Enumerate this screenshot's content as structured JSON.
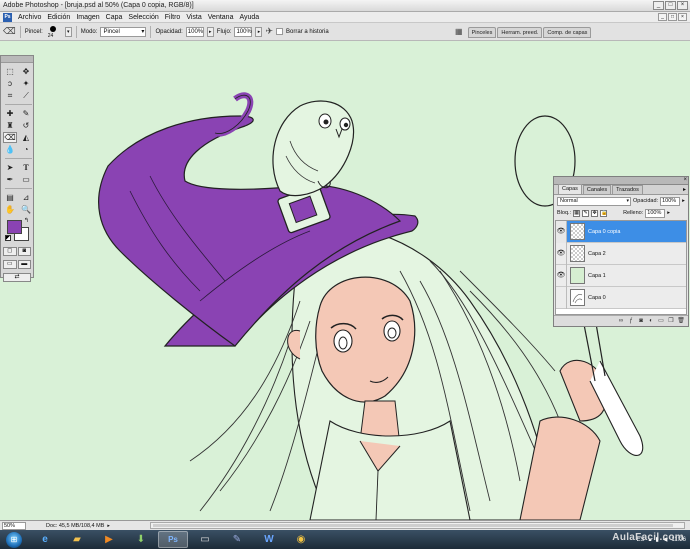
{
  "window": {
    "title": "Adobe Photoshop - [bruja.psd al 50% (Capa 0 copia, RGB/8)]",
    "controls": [
      "_",
      "□",
      "×"
    ]
  },
  "menu": {
    "items": [
      "Archivo",
      "Edición",
      "Imagen",
      "Capa",
      "Selección",
      "Filtro",
      "Vista",
      "Ventana",
      "Ayuda"
    ],
    "doc_controls": [
      "_",
      "□",
      "×"
    ]
  },
  "options": {
    "brush_label": "Pincel:",
    "brush_size": "24",
    "mode_label": "Modo:",
    "mode_value": "Pincel",
    "opacity_label": "Opacidad:",
    "opacity_value": "100%",
    "flow_label": "Flujo:",
    "flow_value": "100%",
    "erase_history_label": "Borrar a historia"
  },
  "docked_tabs": [
    "Pinceles",
    "Herram. preed.",
    "Comp. de capas"
  ],
  "tools": {
    "foreground_color": "#8a43b3",
    "background_color": "#ffffff",
    "active_tool": "eraser-tool"
  },
  "layers_panel": {
    "tabs": [
      "Capas",
      "Canales",
      "Trazados"
    ],
    "blend_mode": "Normal",
    "opacity_label": "Opacidad:",
    "opacity_value": "100%",
    "lock_label": "Bloq.:",
    "fill_label": "Relleno:",
    "fill_value": "100%",
    "layers": [
      {
        "name": "Capa 0 copia",
        "visible": true,
        "selected": true,
        "thumb": "transparent"
      },
      {
        "name": "Capa 2",
        "visible": true,
        "selected": false,
        "thumb": "transparent"
      },
      {
        "name": "Capa 1",
        "visible": true,
        "selected": false,
        "thumb": "green"
      },
      {
        "name": "Capa 0",
        "visible": false,
        "selected": false,
        "thumb": "sketch"
      }
    ]
  },
  "status": {
    "zoom": "50%",
    "doc_info": "Doc: 45,5 MB/108,4 MB"
  },
  "taskbar": {
    "language": "ES",
    "time": "11:26",
    "watermark": "AulaFacil.com"
  },
  "colors": {
    "hat_purple": "#8a43b3",
    "skin": "#f4c8b6",
    "canvas_green": "#d9f1d7",
    "selection_blue": "#3d8ee6"
  }
}
